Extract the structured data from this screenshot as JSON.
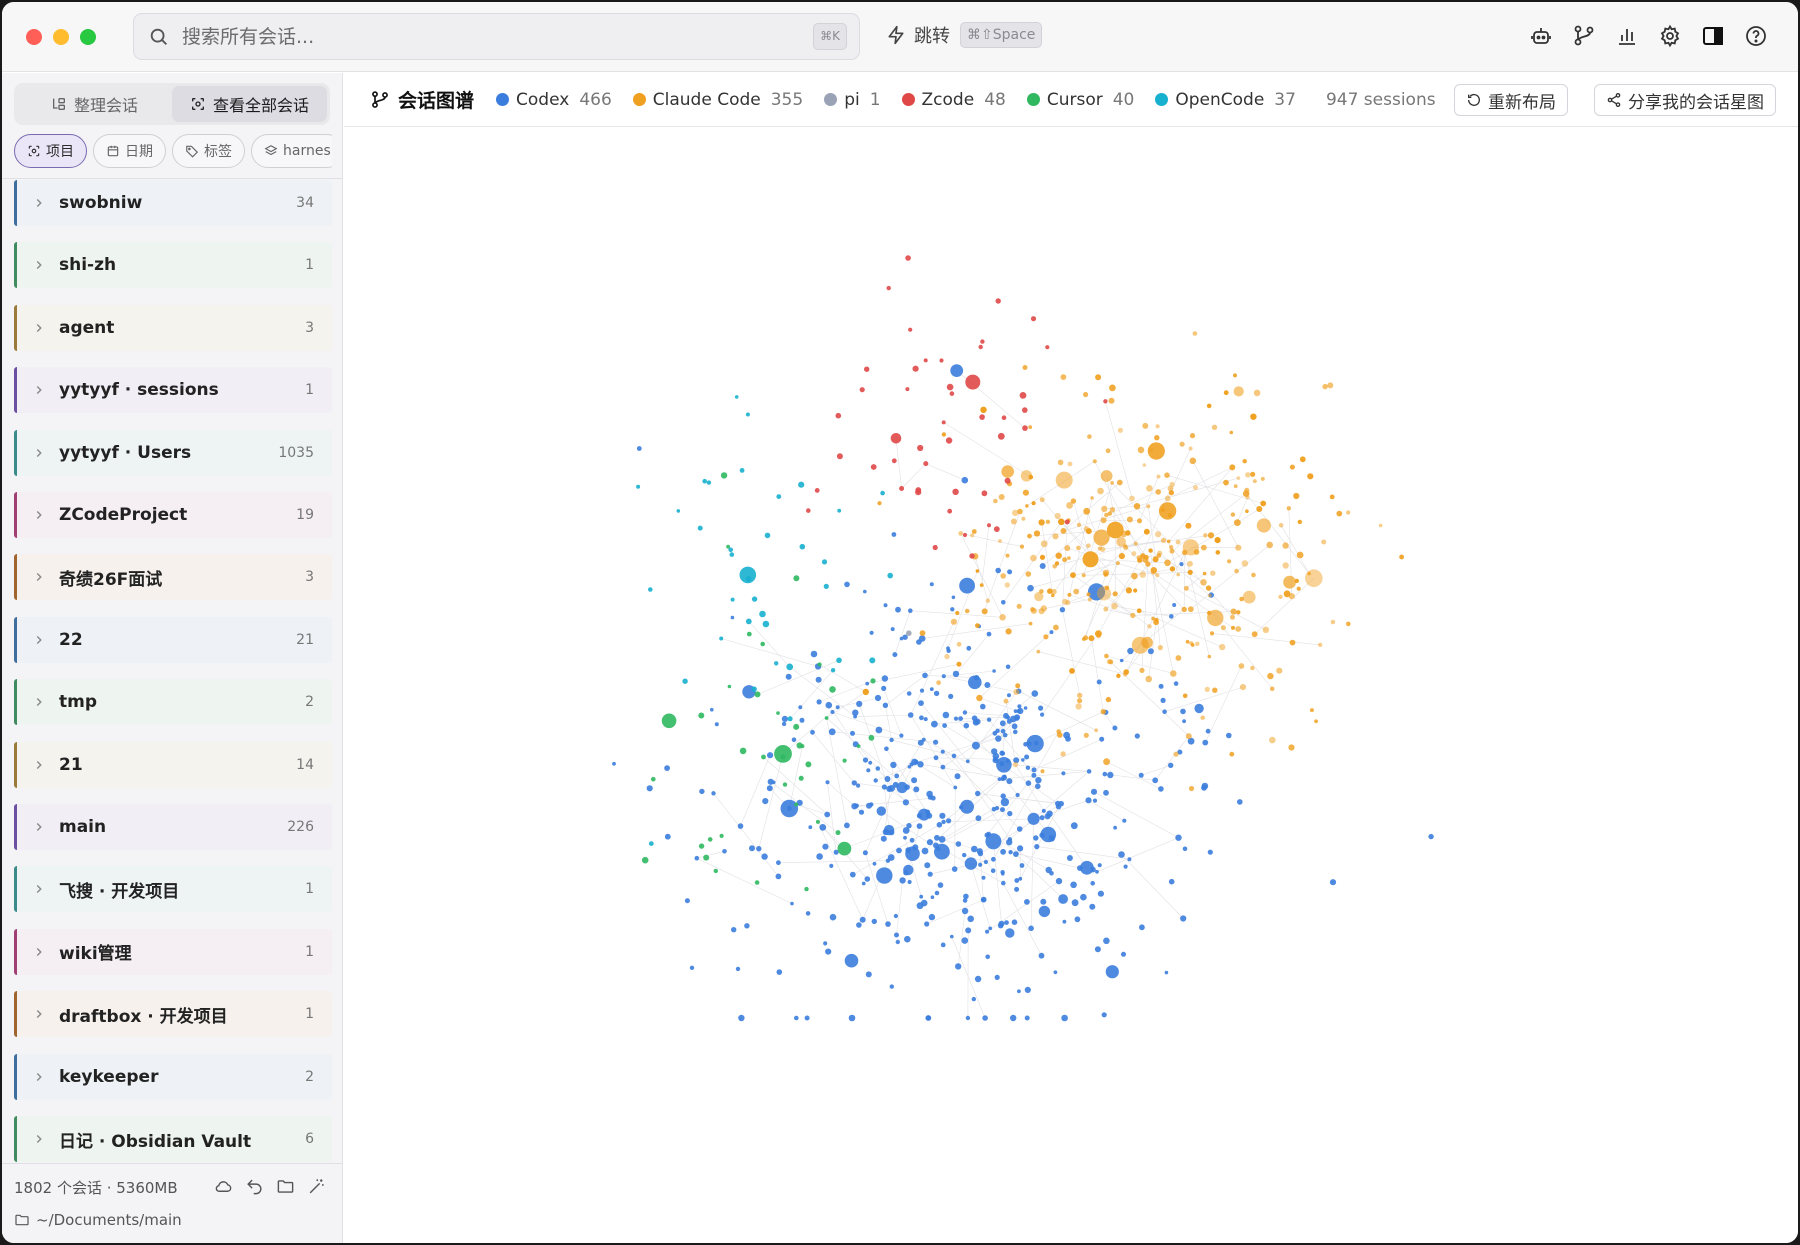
{
  "search": {
    "placeholder": "搜索所有会话...",
    "shortcut": "⌘K"
  },
  "jump": {
    "label": "跳转",
    "shortcut": "⌘⇧Space"
  },
  "toolbar_icons": [
    "bot-icon",
    "branch-icon",
    "bar-chart-icon",
    "gear-icon",
    "sidebar-toggle-icon",
    "help-icon"
  ],
  "sidebar": {
    "tabs": [
      {
        "label": "整理会话",
        "active": false
      },
      {
        "label": "查看全部会话",
        "active": true
      }
    ],
    "filters": [
      {
        "label": "项目",
        "active": true,
        "icon": "project-icon"
      },
      {
        "label": "日期",
        "active": false,
        "icon": "calendar-icon"
      },
      {
        "label": "标签",
        "active": false,
        "icon": "tag-icon"
      },
      {
        "label": "harnes",
        "active": false,
        "icon": "layers-icon"
      }
    ],
    "items": [
      {
        "name": "swobniw",
        "count": "34",
        "color": "#3d6e9e",
        "bg": "#eef2f6"
      },
      {
        "name": "shi-zh",
        "count": "1",
        "color": "#3f8a5e",
        "bg": "#eef4f0"
      },
      {
        "name": "agent",
        "count": "3",
        "color": "#9a7a3a",
        "bg": "#f5f3ee"
      },
      {
        "name": "yytyyf · sessions",
        "count": "1",
        "color": "#6b4fa0",
        "bg": "#f1eff5"
      },
      {
        "name": "yytyyf · Users",
        "count": "1035",
        "color": "#3a8a8a",
        "bg": "#eef4f4"
      },
      {
        "name": "ZCodeProject",
        "count": "19",
        "color": "#a03f74",
        "bg": "#f5eef2"
      },
      {
        "name": "奇绩26F面试",
        "count": "3",
        "color": "#a0652e",
        "bg": "#f6f1ec"
      },
      {
        "name": "22",
        "count": "21",
        "color": "#3d6e9e",
        "bg": "#eef2f6"
      },
      {
        "name": "tmp",
        "count": "2",
        "color": "#3f8a5e",
        "bg": "#eef4f0"
      },
      {
        "name": "21",
        "count": "14",
        "color": "#9a7a3a",
        "bg": "#f5f3ee"
      },
      {
        "name": "main",
        "count": "226",
        "color": "#6b4fa0",
        "bg": "#f1eff5"
      },
      {
        "name": "飞搜 · 开发项目",
        "count": "1",
        "color": "#3a8a8a",
        "bg": "#eef4f4"
      },
      {
        "name": "wiki管理",
        "count": "1",
        "color": "#a03f74",
        "bg": "#f5eef2"
      },
      {
        "name": "draftbox · 开发项目",
        "count": "1",
        "color": "#a0652e",
        "bg": "#f6f1ec"
      },
      {
        "name": "keykeeper",
        "count": "2",
        "color": "#3d6e9e",
        "bg": "#eef2f6"
      },
      {
        "name": "日记 · Obsidian Vault",
        "count": "6",
        "color": "#3f8a5e",
        "bg": "#eef4f0"
      }
    ],
    "footer": {
      "stats": "1802 个会话 · 5360MB",
      "path": "~/Documents/main"
    }
  },
  "graph": {
    "title": "会话图谱",
    "legend": [
      {
        "name": "Codex",
        "count": "466",
        "color": "#3b7ddd"
      },
      {
        "name": "Claude Code",
        "count": "355",
        "color": "#f0a020"
      },
      {
        "name": "pi",
        "count": "1",
        "color": "#9aa3b5"
      },
      {
        "name": "Zcode",
        "count": "48",
        "color": "#e04848"
      },
      {
        "name": "Cursor",
        "count": "40",
        "color": "#2fb860"
      },
      {
        "name": "OpenCode",
        "count": "37",
        "color": "#18b0cf"
      }
    ],
    "sessions_label": "947 sessions",
    "relayout_label": "重新布局",
    "share_label": "分享我的会话星图"
  }
}
